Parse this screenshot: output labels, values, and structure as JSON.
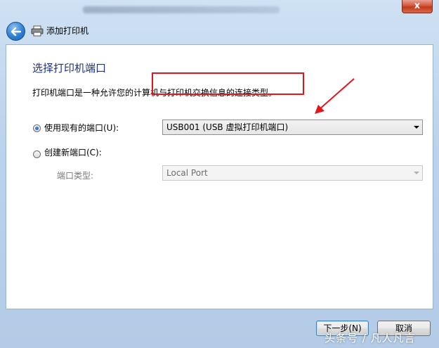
{
  "window": {
    "close_label": "x"
  },
  "nav": {
    "title": "添加打印机"
  },
  "page": {
    "heading": "选择打印机端口",
    "description": "打印机端口是一种允许您的计算机与打印机交换信息的连接类型。"
  },
  "existing_port": {
    "label": "使用现有的端口(U):",
    "selected": true,
    "value": "USB001 (USB 虚拟打印机端口)"
  },
  "new_port": {
    "label": "创建新端口(C):",
    "selected": false,
    "type_label": "端口类型:",
    "type_value": "Local Port"
  },
  "buttons": {
    "next": "下一步(N)",
    "cancel": "取消"
  },
  "watermark": "头条号 / 凡人凡言",
  "colors": {
    "heading": "#1e3287",
    "annotation": "#e3141c",
    "panel_border": "#99b4d1"
  }
}
